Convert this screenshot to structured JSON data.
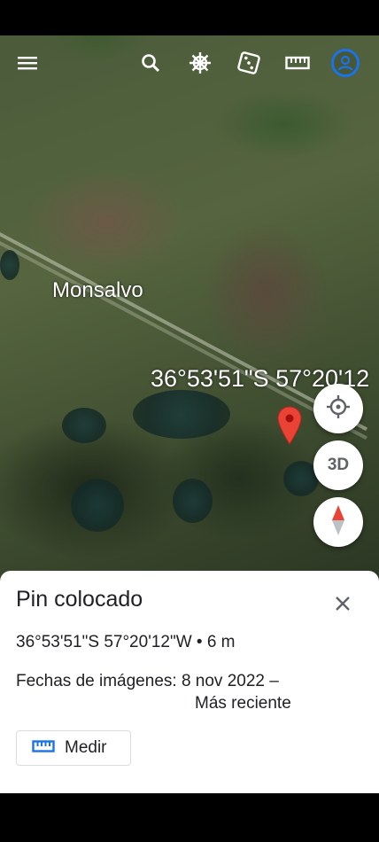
{
  "toolbar": {
    "menu_icon": "menu-icon",
    "search_icon": "search-icon",
    "voyager_icon": "ship-wheel-icon",
    "feeling_lucky_icon": "dice-icon",
    "measure_icon": "ruler-icon",
    "account_icon": "account-icon",
    "accent_color": "#1a73e8"
  },
  "map": {
    "place_label": "Monsalvo",
    "coordinate_label": "36°53'51\"S 57°20'12",
    "pin_color": "#ea4335"
  },
  "controls": {
    "locate_icon": "my-location-icon",
    "view_3d_label": "3D",
    "compass_icon": "compass-icon"
  },
  "info_sheet": {
    "title": "Pin colocado",
    "coordinates": "36°53'51\"S 57°20'12\"W • 6 m",
    "imagery_dates_line1": "Fechas de imágenes: 8 nov 2022 –",
    "imagery_dates_line2": "Más reciente",
    "measure_button_label": "Medir",
    "close_icon": "close-icon"
  }
}
